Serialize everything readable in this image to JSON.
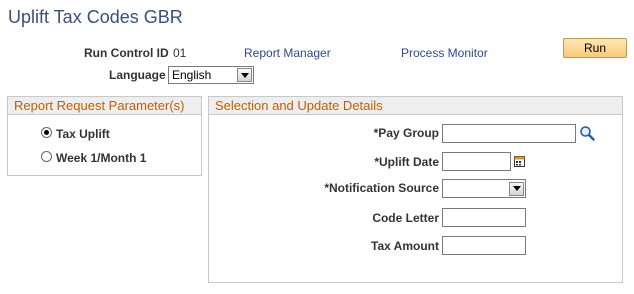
{
  "page": {
    "title": "Uplift Tax Codes GBR"
  },
  "header": {
    "run_control_label": "Run Control ID",
    "run_control_value": "01",
    "report_manager": "Report Manager",
    "process_monitor": "Process Monitor",
    "run_button": "Run",
    "language_label": "Language",
    "language_value": "English"
  },
  "report_params": {
    "title": "Report Request Parameter(s)",
    "options": [
      {
        "label": "Tax Uplift",
        "selected": true
      },
      {
        "label": "Week 1/Month 1",
        "selected": false
      }
    ]
  },
  "selection": {
    "title": "Selection and Update Details",
    "pay_group_label": "*Pay Group",
    "pay_group_value": "",
    "uplift_date_label": "*Uplift Date",
    "uplift_date_value": "",
    "notification_source_label": "*Notification Source",
    "notification_source_value": "",
    "code_letter_label": "Code Letter",
    "code_letter_value": "",
    "tax_amount_label": "Tax Amount",
    "tax_amount_value": ""
  },
  "icons": {
    "lookup": "magnifier-lookup-icon",
    "calendar": "calendar-icon",
    "dropdown": "chevron-down-icon"
  },
  "colors": {
    "title": "#3a4f7a",
    "link": "#2b4a90",
    "group_header_text": "#c06000",
    "run_button": "#f8c97a"
  }
}
